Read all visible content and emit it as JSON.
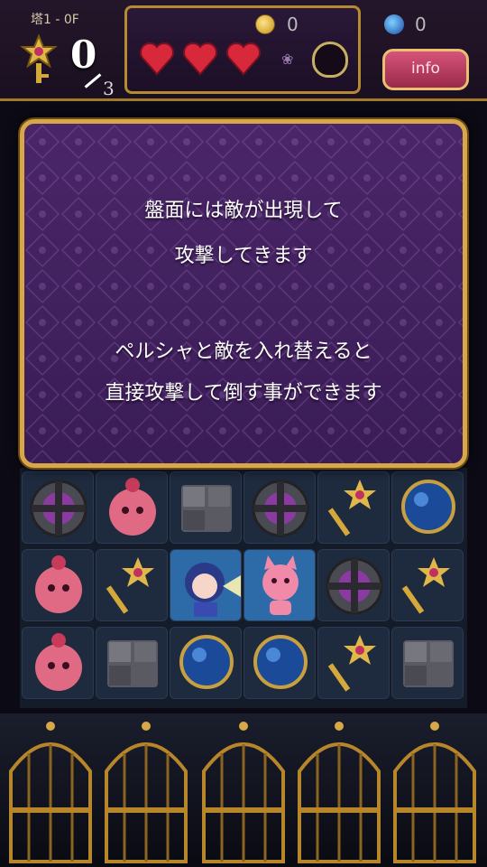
{
  "hud": {
    "floor": "塔1 - 0F",
    "keys_collected": "0",
    "keys_total": "3",
    "coins": "0",
    "gems": "0",
    "info_label": "info",
    "hearts": 3
  },
  "dialog": {
    "paragraph1": [
      "盤面には敵が出現して",
      "攻撃してきます"
    ],
    "paragraph2": [
      "ペルシャと敵を入れ替えると",
      "直接攻撃して倒す事ができます"
    ]
  },
  "board": {
    "rows": [
      [
        "shield",
        "pink-creature",
        "stone-block",
        "shield",
        "gold-key",
        "blue-orb"
      ],
      [
        "pink-creature",
        "gold-key",
        "persha-hero",
        "pink-cat-enemy",
        "shield",
        "gold-key"
      ],
      [
        "pink-creature",
        "stone-block",
        "blue-orb",
        "blue-orb",
        "gold-key",
        "stone-block"
      ]
    ],
    "highlighted": [
      [
        1,
        2
      ],
      [
        1,
        3
      ]
    ]
  },
  "cages": 5,
  "colors": {
    "gold": "#d8a848",
    "dialog_purple": "#4a2668",
    "info_pink": "#d6547a"
  }
}
